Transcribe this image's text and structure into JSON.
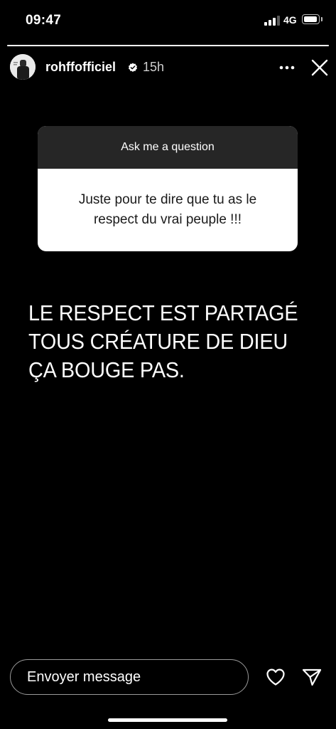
{
  "status_bar": {
    "time": "09:47",
    "network": "4G",
    "signal_bars": 4,
    "signal_active": 3
  },
  "story": {
    "progress": 1.0,
    "username": "rohffofficiel",
    "time_ago": "15h",
    "text": "LE RESPECT EST PARTAGÉ TOUS CRÉATURE DE DIEU ÇA BOUGE PAS."
  },
  "question_sticker": {
    "title": "Ask me a question",
    "answer": "Juste pour te dire que tu as le respect du vrai peuple !!!"
  },
  "reply": {
    "placeholder": "Envoyer message"
  },
  "icons": {
    "avatar": "avatar",
    "verified": "verified-badge-icon",
    "more": "more-options-icon",
    "close": "close-icon",
    "like": "heart-icon",
    "share": "send-icon"
  },
  "colors": {
    "background": "#000000",
    "sticker_header": "#262626",
    "sticker_body": "#ffffff"
  }
}
